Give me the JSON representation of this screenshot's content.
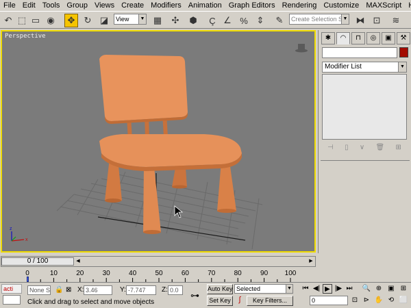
{
  "menu": [
    "File",
    "Edit",
    "Tools",
    "Group",
    "Views",
    "Create",
    "Modifiers",
    "Animation",
    "Graph Editors",
    "Rendering",
    "Customize",
    "MAXScript",
    "Help"
  ],
  "toolbar": {
    "coord_system": "View",
    "selection_set": "Create Selection Set"
  },
  "viewport": {
    "label": "Perspective",
    "border_color": "#f0dc00",
    "chair_color": "#e0874d"
  },
  "command_panel": {
    "tabs": [
      "create-tab",
      "modify-tab",
      "hierarchy-tab",
      "motion-tab",
      "display-tab",
      "utilities-tab"
    ],
    "modifier_list": "Modifier List",
    "color_swatch": "#a30b00"
  },
  "time_slider": {
    "frame_label": "0 / 100",
    "current": 0,
    "total": 100
  },
  "trackbar": {
    "ticks": [
      "0",
      "10",
      "20",
      "30",
      "40",
      "50",
      "60",
      "70",
      "80",
      "90",
      "100"
    ]
  },
  "status": {
    "script_box": "acti",
    "selection": "None S",
    "x_label": "X:",
    "x_value": "3.46",
    "y_label": "Y:",
    "y_value": "-7.747",
    "z_label": "Z:",
    "z_value": "0.0",
    "prompt": "Click and drag to select and move objects",
    "auto_key": "Auto Key",
    "set_key": "Set Key",
    "key_mode": "Selected",
    "key_filters": "Key Filters...",
    "frame_field": "0"
  }
}
